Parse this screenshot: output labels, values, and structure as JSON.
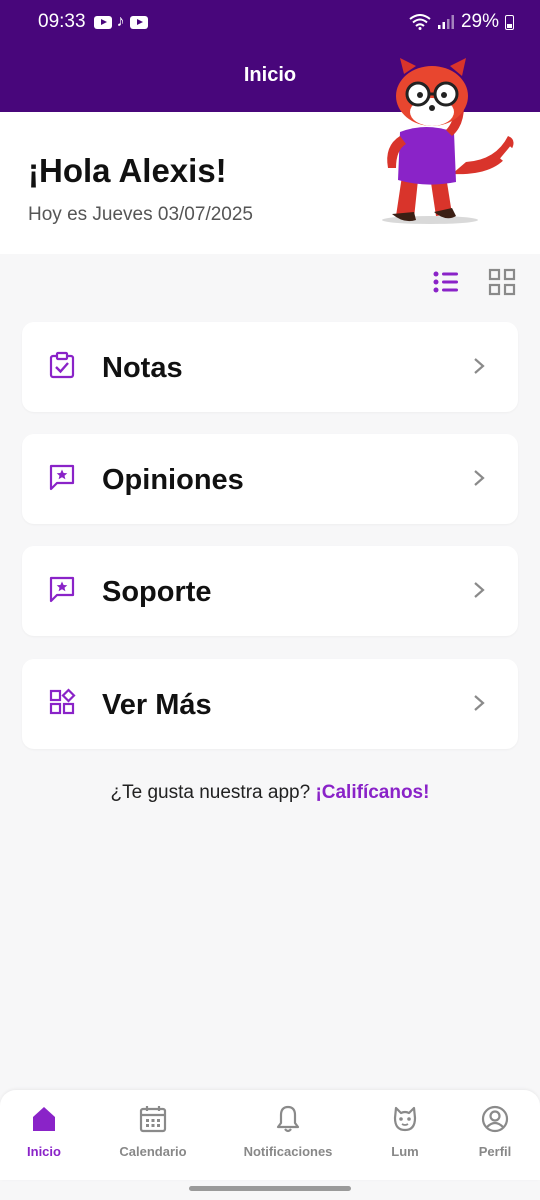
{
  "status_bar": {
    "time": "09:33",
    "battery": "29%"
  },
  "app_bar": {
    "title": "Inicio"
  },
  "header": {
    "greeting": "¡Hola Alexis!",
    "date": "Hoy es Jueves 03/07/2025"
  },
  "view_toggle": {
    "active": "list"
  },
  "menu": [
    {
      "label": "Notas",
      "icon": "clipboard-check-icon"
    },
    {
      "label": "Opiniones",
      "icon": "comment-star-icon"
    },
    {
      "label": "Soporte",
      "icon": "comment-star-icon"
    },
    {
      "label": "Ver Más",
      "icon": "apps-icon"
    }
  ],
  "rate": {
    "question": "¿Te gusta nuestra app?",
    "cta": "¡Califícanos!"
  },
  "bottom_nav": [
    {
      "label": "Inicio",
      "icon": "home-icon",
      "active": true
    },
    {
      "label": "Calendario",
      "icon": "calendar-icon",
      "active": false
    },
    {
      "label": "Notificaciones",
      "icon": "bell-icon",
      "active": false
    },
    {
      "label": "Lum",
      "icon": "mascot-icon",
      "active": false
    },
    {
      "label": "Perfil",
      "icon": "profile-icon",
      "active": false
    }
  ],
  "colors": {
    "brand": "#48067b",
    "accent": "#8a23c8",
    "inactive": "#888888"
  }
}
